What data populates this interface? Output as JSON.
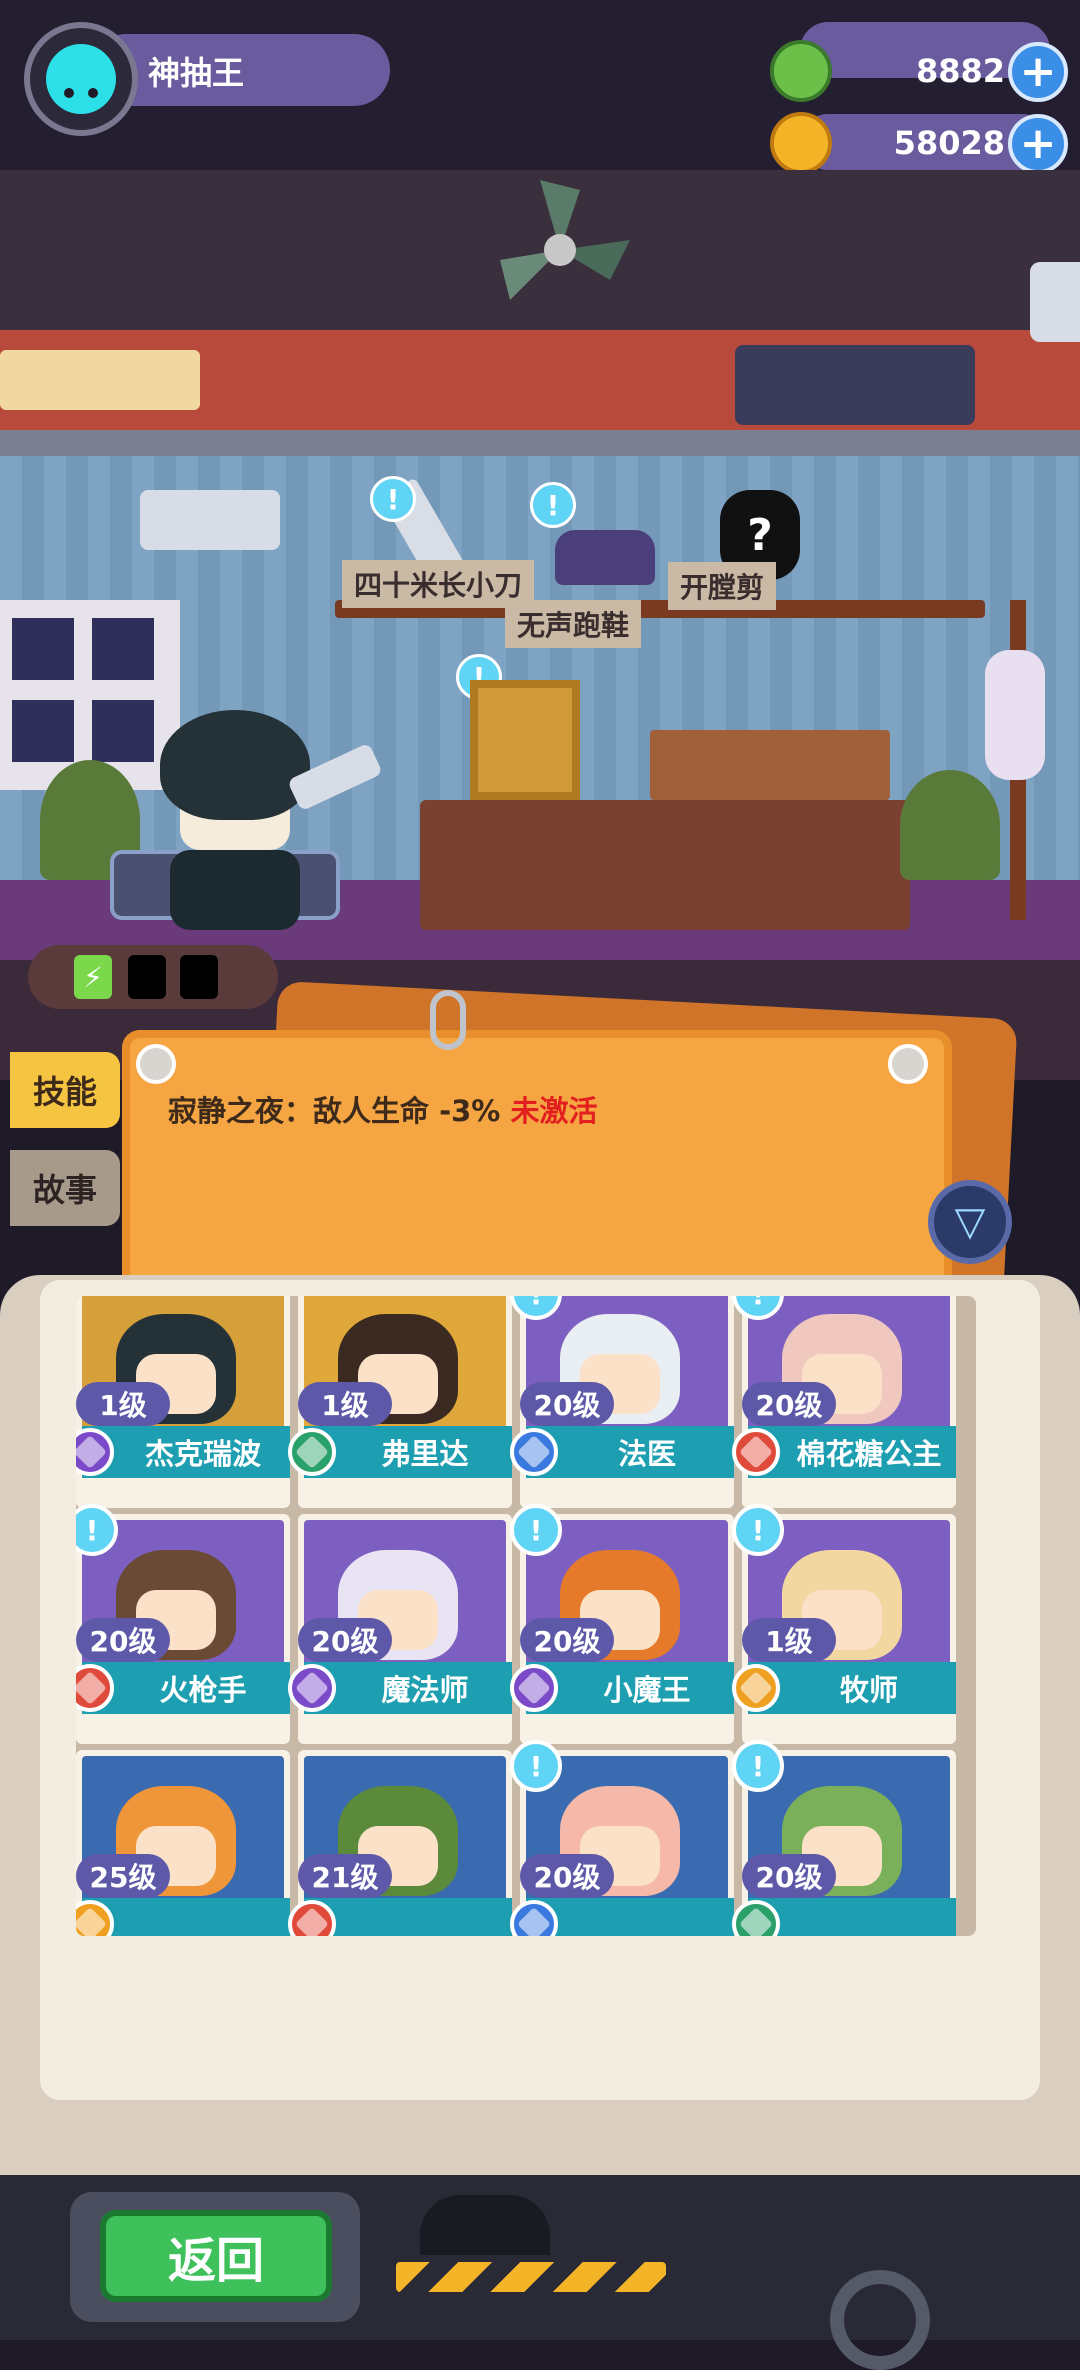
{
  "player": {
    "name": "神抽王",
    "avatar_icon": "cat-avatar-icon"
  },
  "currencies": [
    {
      "name": "gem",
      "icon": "green-gem-icon",
      "value": "8882",
      "color": "#6cc04a"
    },
    {
      "name": "coin",
      "icon": "planet-coin-icon",
      "value": "58028",
      "color": "#f3b428"
    }
  ],
  "shelf_items": [
    {
      "label": "四十米长小刀",
      "icon": "knife-icon"
    },
    {
      "label": "无声跑鞋",
      "icon": "sneaker-icon"
    },
    {
      "label": "开膛剪",
      "icon": "scissors-icon",
      "unknown_mark": "?"
    }
  ],
  "notice_mark": "!",
  "tabs": {
    "skill": "技能",
    "story": "故事"
  },
  "skill": {
    "text": "寂静之夜：敌人生命 -3%",
    "status": "未激活",
    "status_color": "#e21e1e"
  },
  "filter_icon": "funnel-icon",
  "characters": [
    {
      "level": "1级",
      "name": "杰克瑞波",
      "rarity_color": "#7a4ac8",
      "art_color": "#d5a03a",
      "char_color": "#243238",
      "alert": false
    },
    {
      "level": "1级",
      "name": "弗里达",
      "rarity_color": "#2aa06a",
      "art_color": "#e0a83a",
      "char_color": "#3a2a22",
      "alert": false
    },
    {
      "level": "20级",
      "name": "法医",
      "rarity_color": "#3a7ae0",
      "art_color": "#7c5fc0",
      "char_color": "#e8eef2",
      "alert": true
    },
    {
      "level": "20级",
      "name": "棉花糖公主",
      "rarity_color": "#e04a3a",
      "art_color": "#7c5fc0",
      "char_color": "#f0c8c0",
      "alert": true
    },
    {
      "level": "20级",
      "name": "火枪手",
      "rarity_color": "#e04a3a",
      "art_color": "#7c5fc0",
      "char_color": "#6a4a34",
      "alert": true
    },
    {
      "level": "20级",
      "name": "魔法师",
      "rarity_color": "#7a4ac8",
      "art_color": "#7c5fc0",
      "char_color": "#e8e4f4",
      "alert": false
    },
    {
      "level": "20级",
      "name": "小魔王",
      "rarity_color": "#7a4ac8",
      "art_color": "#7c5fc0",
      "char_color": "#e47a2a",
      "alert": true
    },
    {
      "level": "1级",
      "name": "牧师",
      "rarity_color": "#f0a020",
      "art_color": "#7c5fc0",
      "char_color": "#f2d8a0",
      "alert": true
    },
    {
      "level": "25级",
      "name": "",
      "rarity_color": "#f0a020",
      "art_color": "#3a6ab0",
      "char_color": "#f0963a",
      "alert": false
    },
    {
      "level": "21级",
      "name": "",
      "rarity_color": "#e04a3a",
      "art_color": "#3a6ab0",
      "char_color": "#5a8a3a",
      "alert": false
    },
    {
      "level": "20级",
      "name": "",
      "rarity_color": "#3a7ae0",
      "art_color": "#3a6ab0",
      "char_color": "#f6b8a8",
      "alert": true
    },
    {
      "level": "20级",
      "name": "",
      "rarity_color": "#2aa06a",
      "art_color": "#3a6ab0",
      "char_color": "#7ab05a",
      "alert": true
    }
  ],
  "energy": {
    "filled": 1,
    "total": 3,
    "icon": "lightning-icon"
  },
  "back_button": "返回"
}
